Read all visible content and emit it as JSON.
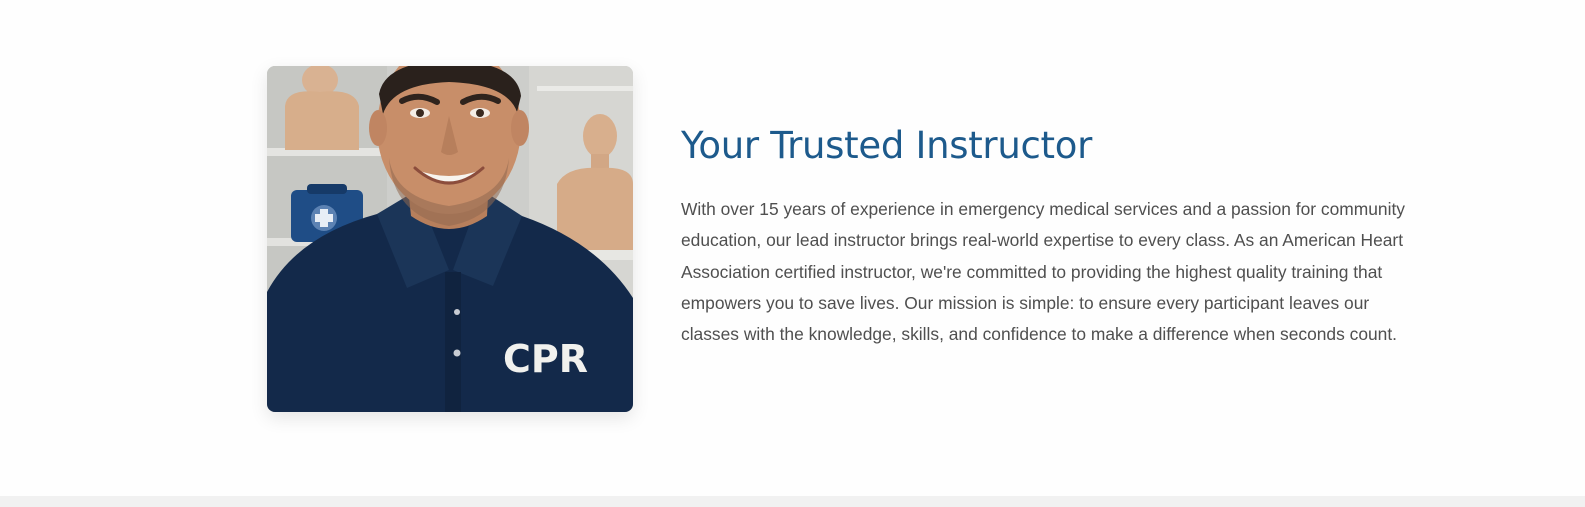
{
  "about": {
    "heading": "Your Trusted Instructor",
    "paragraph": "With over 15 years of experience in emergency medical services and a passion for community education, our lead instructor brings real-world expertise to every class. As an American Heart Association certified instructor, we're committed to providing the highest quality training that empowers you to save lives. Our mission is simple: to ensure every participant leaves our classes with the knowledge, skills, and confidence to make a difference when seconds count.",
    "photo": {
      "shirt_text": "CPR",
      "shirt_color": "#13294a",
      "background_color": "#cfd0cc"
    }
  },
  "colors": {
    "heading": "#1d5a8c",
    "body_text": "#4f4f4f",
    "page_background": "#fefefe"
  }
}
